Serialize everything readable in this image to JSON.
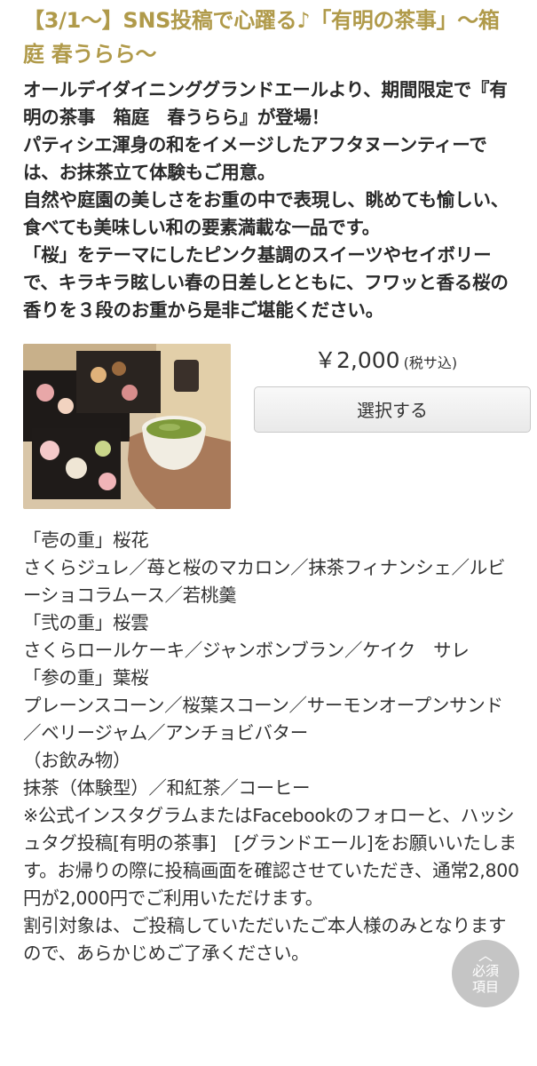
{
  "header": {
    "title": "【3/1〜】SNS投稿で心躍る♪「有明の茶事」〜箱庭 春うらら〜"
  },
  "intro": [
    "オールデイダイニンググランドエールより、期間限定で『有明の茶事　箱庭　春うらら』が登場！",
    "パティシエ渾身の和をイメージしたアフタヌーンティーでは、お抹茶立て体験もご用意。",
    "自然や庭園の美しさをお重の中で表現し、眺めても愉しい、食べても美味しい和の要素満載な一品です。",
    "「桜」をテーマにしたピンク基調のスイーツやセイボリーで、キラキラ眩しい春の日差しとともに、フワッと香る桜の香りを３段のお重から是非ご堪能ください。"
  ],
  "product": {
    "price": "￥2,000",
    "tax_note": "(税サ込)",
    "select_label": "選択する"
  },
  "menu": [
    "「壱の重」桜花",
    "さくらジュレ／苺と桜のマカロン／抹茶フィナンシェ／ルビーショコラムース／若桃羹",
    "「弐の重」桜雲",
    "さくらロールケーキ／ジャンボンブラン／ケイク　サレ",
    "「参の重」葉桜",
    "プレーンスコーン／桜葉スコーン／サーモンオープンサンド／ベリージャム／アンチョビバター",
    "（お飲み物）",
    "抹茶（体験型）／和紅茶／コーヒー",
    "※公式インスタグラムまたはFacebookのフォローと、ハッシュタグ投稿[有明の茶事]　[グランドエール]をお願いいたします。お帰りの際に投稿画面を確認させていただき、通常2,800円が2,000円でご利用いただけます。",
    "割引対象は、ご投稿していただいたご本人様のみとなりますので、あらかじめご了承ください。"
  ],
  "badge": {
    "line1": "必須",
    "line2": "項目",
    "icon": "chevron-up-icon"
  }
}
